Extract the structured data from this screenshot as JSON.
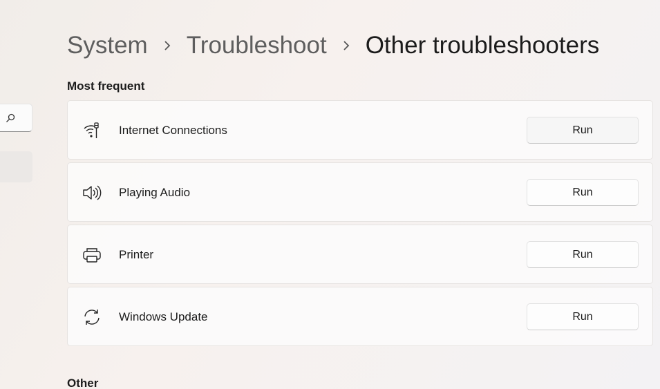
{
  "breadcrumb": [
    {
      "label": "System"
    },
    {
      "label": "Troubleshoot"
    },
    {
      "label": "Other troubleshooters"
    }
  ],
  "sections": {
    "most_frequent": "Most frequent",
    "other": "Other"
  },
  "items": [
    {
      "label": "Internet Connections",
      "icon": "wifi-ethernet-icon",
      "button": "Run"
    },
    {
      "label": "Playing Audio",
      "icon": "speaker-icon",
      "button": "Run"
    },
    {
      "label": "Printer",
      "icon": "printer-icon",
      "button": "Run"
    },
    {
      "label": "Windows Update",
      "icon": "sync-icon",
      "button": "Run"
    }
  ]
}
